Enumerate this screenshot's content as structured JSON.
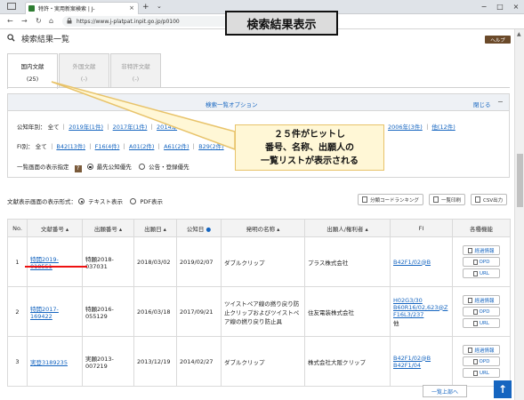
{
  "browser": {
    "tab_title": "特許・実用新案検索 | J-",
    "url": "https://www.j-platpat.inpit.go.jp/p0100",
    "new_tab": "+",
    "tab_close": "×",
    "window_controls": [
      "−",
      "□",
      "×"
    ]
  },
  "banner": "検索結果表示",
  "page": {
    "title": "検索結果一覧",
    "help": "ヘルプ"
  },
  "doc_tabs": [
    {
      "label": "国内文献",
      "count": "(25)"
    },
    {
      "label": "外国文献",
      "count": "(-)"
    },
    {
      "label": "非特許文献",
      "count": "(-)"
    }
  ],
  "options": {
    "header": "検索一覧オプション",
    "close": "閉じる",
    "collapse": "−",
    "year_label": "公知年別：",
    "year_all": "全て",
    "years": [
      "2019年(1件)",
      "2017年(1件)",
      "2014年"
    ],
    "year_tail": [
      "2006年(3件)",
      "他(12件)"
    ],
    "fi_label": "FI別：",
    "fi_all": "全て",
    "fi": [
      "B42(13件)",
      "F16(4件)",
      "A01(2件)",
      "A61(2件)",
      "B29(2件)"
    ],
    "display_label": "一覧画面の表示指定",
    "display_options": [
      "最先公知優先",
      "公告・登録優先"
    ]
  },
  "callout": {
    "lines": [
      "２５件がヒットし",
      "番号、名称、出願人の",
      "一覧リストが表示される"
    ]
  },
  "format": {
    "label": "文献表示画面の表示形式：",
    "options": [
      "テキスト表示",
      "PDF表示"
    ]
  },
  "actions": [
    "分類コードランキング",
    "一覧印刷",
    "CSV出力"
  ],
  "table": {
    "headers": [
      "No.",
      "文献番号",
      "出願番号",
      "出願日",
      "公知日",
      "発明の名称",
      "出願人/権利者",
      "FI",
      "各種機能"
    ],
    "rows": [
      {
        "no": "1",
        "doc": "特開2019-018551",
        "app": "特願2018-037031",
        "app_date": "2018/03/02",
        "pub_date": "2019/02/07",
        "title": "ダブルクリップ",
        "applicant": "プラス株式会社",
        "fi": [
          "B42F1/02@B"
        ]
      },
      {
        "no": "2",
        "doc": "特開2017-169422",
        "app": "特願2016-055129",
        "app_date": "2016/03/18",
        "pub_date": "2017/09/21",
        "title": "ツイストペア線の撚り戻り防止クリップおよびツイストペア線の撚り戻り防止具",
        "applicant": "住友電装株式会社",
        "fi": [
          "H02G3/30",
          "B60R16/02,623@Z",
          "F16L3/237",
          "他"
        ]
      },
      {
        "no": "3",
        "doc": "実登3189235",
        "app": "実願2013-007219",
        "app_date": "2013/12/19",
        "pub_date": "2014/02/27",
        "title": "ダブルクリップ",
        "applicant": "株式会社大阪クリップ",
        "fi": [
          "B42F1/02@B",
          "B42F1/04"
        ]
      }
    ],
    "functions": [
      "経過情報",
      "OPD",
      "URL"
    ]
  },
  "footer": {
    "to_top": "一覧上部へ",
    "up_arrow": "↑"
  },
  "colors": {
    "link": "#1565c0",
    "help_bg": "#6b4a2a",
    "callout_bg": "#fff7d6",
    "highlight": "#e11111"
  }
}
